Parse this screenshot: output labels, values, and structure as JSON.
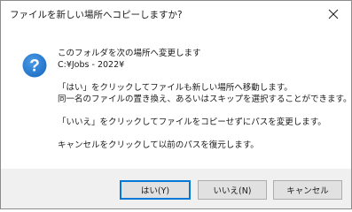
{
  "dialog": {
    "title": "ファイルを新しい場所へコピーしますか?",
    "icon": "info-question-icon",
    "accent_color": "#0078d7",
    "icon_color": "#1f6fc5"
  },
  "message": {
    "line1": "このフォルダを次の場所へ変更します",
    "path": "C:¥Jobs - 2022¥",
    "line3": "「はい」をクリックしてファイルも新しい場所へ移動します。",
    "line4": "同一名のファイルの置き換え、あるいはスキップを選択することができます。",
    "line5": "「いいえ」をクリックしてファイルをコピーせずにパスを変更します。",
    "line6": "キャンセルをクリックして以前のパスを復元します。"
  },
  "buttons": {
    "yes": "はい(Y)",
    "no": "いいえ(N)",
    "cancel": "キャンセル"
  }
}
